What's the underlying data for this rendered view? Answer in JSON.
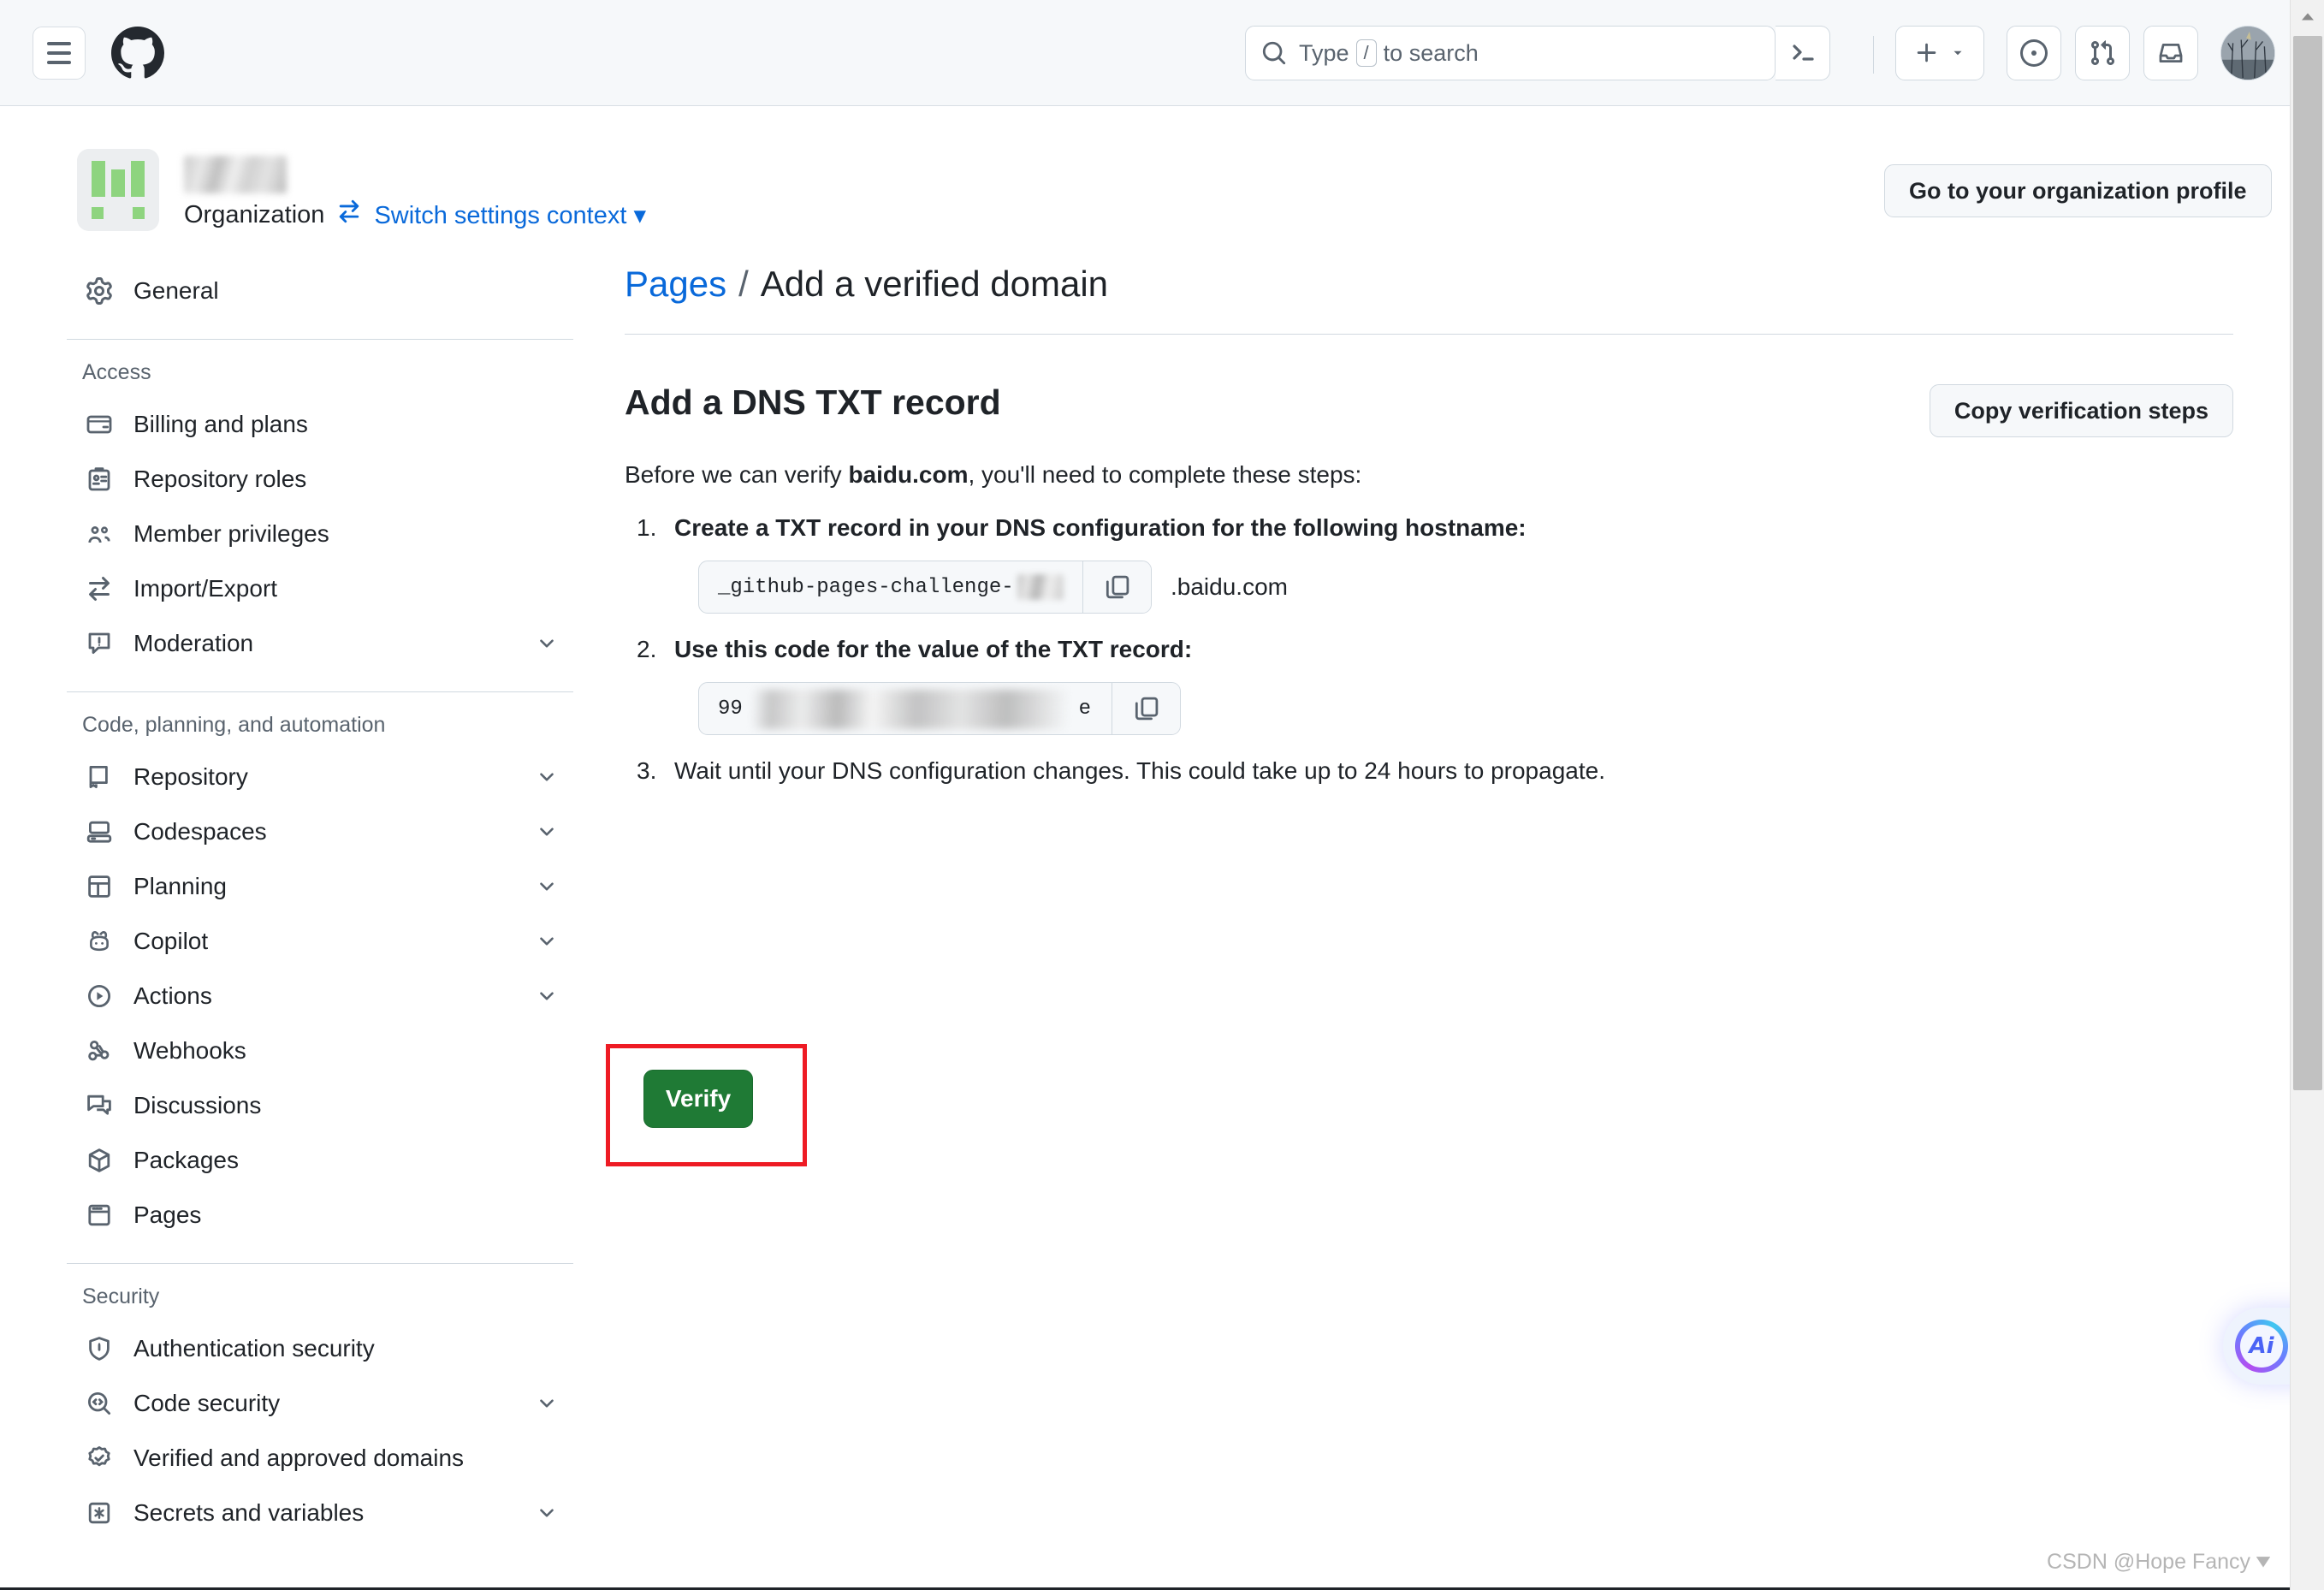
{
  "header": {
    "menu_icon": "hamburger-menu-icon",
    "logo_icon": "github-logo-icon",
    "search": {
      "icon": "search-icon",
      "placeholder_prefix": "Type",
      "placeholder_key": "/",
      "placeholder_suffix": "to search",
      "value": ""
    },
    "terminal_icon": "terminal-icon",
    "create_icon": "plus-icon",
    "create_chevron": "chevron-down-icon",
    "issues_icon": "issue-opened-icon",
    "pull_requests_icon": "git-pull-request-icon",
    "inbox_icon": "inbox-icon",
    "avatar": "user-avatar"
  },
  "org": {
    "avatar_alt": "organization-avatar",
    "name_redacted": "",
    "type_label": "Organization",
    "switch_icon": "arrow-switch-icon",
    "switch_label": "Switch settings context",
    "switch_chevron": "▾",
    "profile_button": "Go to your organization profile"
  },
  "sidebar": {
    "top": [
      {
        "label": "General",
        "icon": "gear-icon",
        "expandable": false
      }
    ],
    "sections": [
      {
        "title": "Access",
        "items": [
          {
            "label": "Billing and plans",
            "icon": "credit-card-icon",
            "expandable": false
          },
          {
            "label": "Repository roles",
            "icon": "id-badge-icon",
            "expandable": false
          },
          {
            "label": "Member privileges",
            "icon": "people-icon",
            "expandable": false
          },
          {
            "label": "Import/Export",
            "icon": "arrow-switch-icon",
            "expandable": false
          },
          {
            "label": "Moderation",
            "icon": "report-icon",
            "expandable": true
          }
        ]
      },
      {
        "title": "Code, planning, and automation",
        "items": [
          {
            "label": "Repository",
            "icon": "repo-icon",
            "expandable": true
          },
          {
            "label": "Codespaces",
            "icon": "codespaces-icon",
            "expandable": true
          },
          {
            "label": "Planning",
            "icon": "project-icon",
            "expandable": true
          },
          {
            "label": "Copilot",
            "icon": "copilot-icon",
            "expandable": true
          },
          {
            "label": "Actions",
            "icon": "play-icon",
            "expandable": true
          },
          {
            "label": "Webhooks",
            "icon": "webhook-icon",
            "expandable": false
          },
          {
            "label": "Discussions",
            "icon": "comment-discussion-icon",
            "expandable": false
          },
          {
            "label": "Packages",
            "icon": "package-icon",
            "expandable": false
          },
          {
            "label": "Pages",
            "icon": "browser-icon",
            "expandable": false
          }
        ]
      },
      {
        "title": "Security",
        "items": [
          {
            "label": "Authentication security",
            "icon": "shield-lock-icon",
            "expandable": false
          },
          {
            "label": "Code security",
            "icon": "codescan-icon",
            "expandable": true
          },
          {
            "label": "Verified and approved domains",
            "icon": "verified-icon",
            "expandable": false
          },
          {
            "label": "Secrets and variables",
            "icon": "key-asterisk-icon",
            "expandable": true
          }
        ]
      }
    ]
  },
  "main": {
    "breadcrumb": {
      "parent": "Pages",
      "separator": "/",
      "current": "Add a verified domain"
    },
    "section_title": "Add a DNS TXT record",
    "copy_steps_button": "Copy verification steps",
    "intro_prefix": "Before we can verify ",
    "intro_domain": "baidu.com",
    "intro_suffix": ", you'll need to complete these steps:",
    "steps": [
      {
        "number": "1.",
        "text": "Create a TXT record in your DNS configuration for the following hostname:",
        "bold": true
      },
      {
        "number": "2.",
        "text": "Use this code for the value of the TXT record:",
        "bold": true
      },
      {
        "number": "3.",
        "text": "Wait until your DNS configuration changes. This could take up to 24 hours to propagate.",
        "bold": false
      }
    ],
    "hostname_field": {
      "value": "_github-pages-challenge-",
      "redacted": true,
      "copy_icon": "copy-icon",
      "suffix": ".baidu.com"
    },
    "code_field": {
      "value_start": "99",
      "value_end": "e",
      "redacted": true,
      "copy_icon": "copy-icon"
    },
    "verify_button": "Verify"
  },
  "ai_widget": {
    "label": "Ai"
  },
  "watermark": {
    "text": "CSDN @Hope Fancy"
  },
  "colors": {
    "accent_blue": "#0969da",
    "verify_green": "#1f7a35",
    "annotation_red": "#ee1b24",
    "header_bg": "#f6f8fa",
    "border": "#d1d9e0",
    "text": "#1f2328",
    "muted_text": "#59636e"
  }
}
